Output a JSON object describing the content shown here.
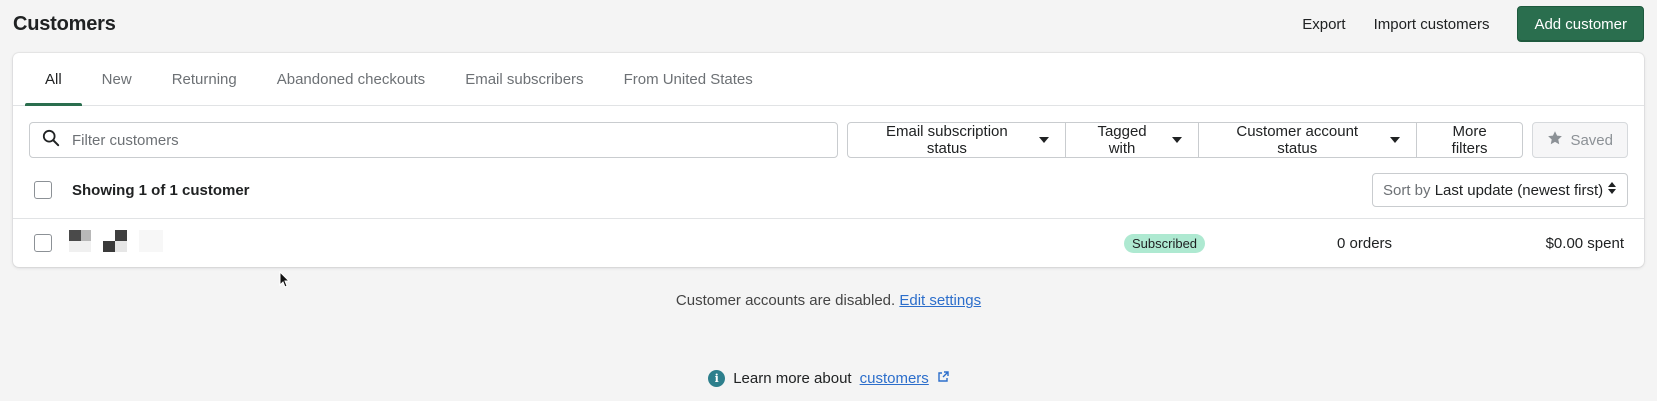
{
  "header": {
    "title": "Customers",
    "export_label": "Export",
    "import_label": "Import customers",
    "add_label": "Add customer"
  },
  "tabs": [
    {
      "label": "All",
      "active": true
    },
    {
      "label": "New"
    },
    {
      "label": "Returning"
    },
    {
      "label": "Abandoned checkouts"
    },
    {
      "label": "Email subscribers"
    },
    {
      "label": "From United States"
    }
  ],
  "filters": {
    "search_placeholder": "Filter customers",
    "email_status": "Email subscription status",
    "tagged_with": "Tagged with",
    "account_status": "Customer account status",
    "more_filters": "More filters",
    "saved": "Saved"
  },
  "list": {
    "showing": "Showing 1 of 1 customer",
    "sort_prefix": "Sort by",
    "sort_value": "Last update (newest first)"
  },
  "rows": [
    {
      "status": "Subscribed",
      "orders": "0 orders",
      "spent": "$0.00 spent"
    }
  ],
  "footer": {
    "accounts_text": "Customer accounts are disabled.",
    "edit_link": "Edit settings",
    "learn_text": "Learn more about",
    "learn_link": "customers"
  },
  "colors": {
    "primary": "#2a6e4e",
    "badge": "#aee9d1",
    "link": "#2c6ecb"
  }
}
